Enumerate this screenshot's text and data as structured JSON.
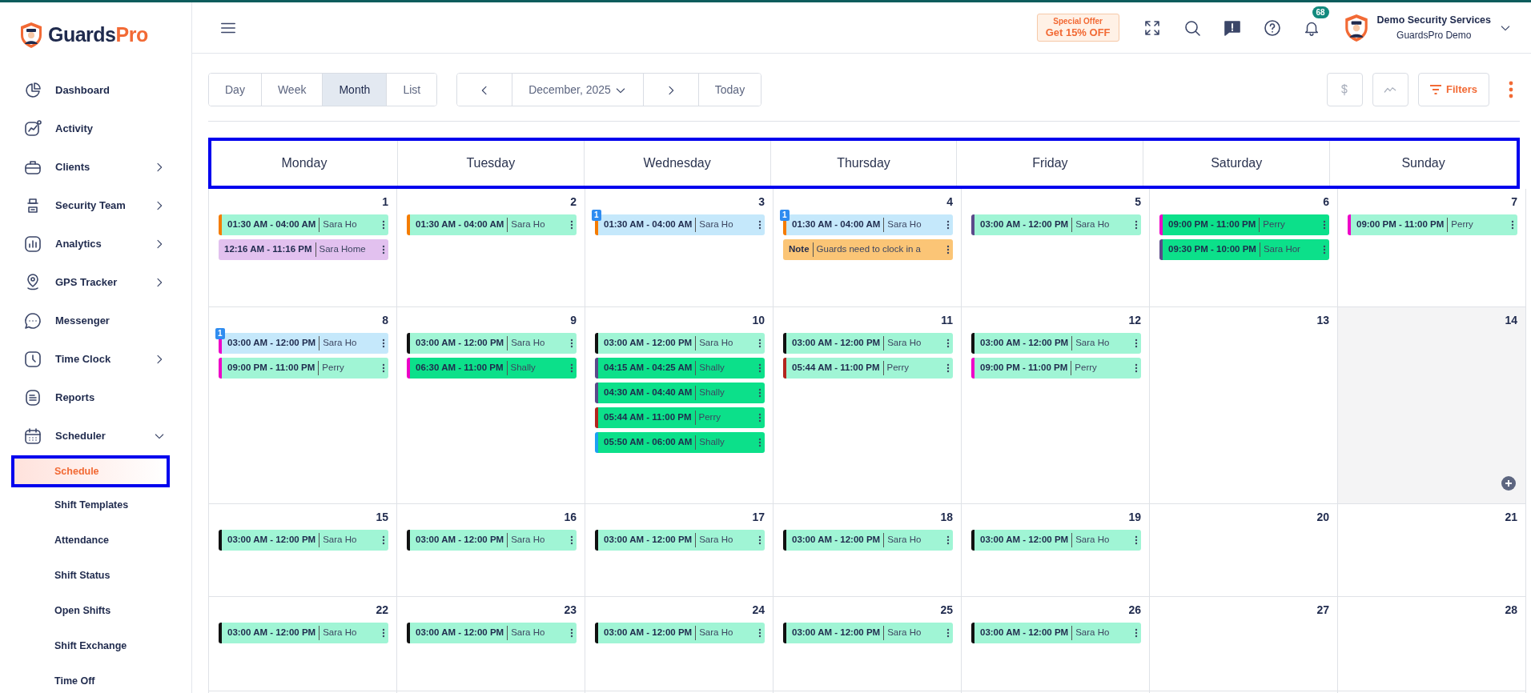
{
  "brand": {
    "main": "Guards",
    "accent": "Pro"
  },
  "sidebar": {
    "items": [
      {
        "label": "Dashboard"
      },
      {
        "label": "Activity"
      },
      {
        "label": "Clients",
        "expanded": false
      },
      {
        "label": "Security Team",
        "expanded": false
      },
      {
        "label": "Analytics",
        "expanded": false
      },
      {
        "label": "GPS Tracker",
        "expanded": false
      },
      {
        "label": "Messenger"
      },
      {
        "label": "Time Clock",
        "expanded": false
      },
      {
        "label": "Reports"
      },
      {
        "label": "Scheduler",
        "expanded": true,
        "children": [
          {
            "label": "Schedule",
            "selected": true
          },
          {
            "label": "Shift Templates",
            "selected": false
          },
          {
            "label": "Attendance",
            "selected": false
          },
          {
            "label": "Shift Status",
            "selected": false
          },
          {
            "label": "Open Shifts",
            "selected": false
          },
          {
            "label": "Shift Exchange",
            "selected": false
          },
          {
            "label": "Time Off",
            "selected": false
          }
        ]
      }
    ]
  },
  "topbar": {
    "offer": {
      "title": "Special Offer",
      "text": "Get 15% OFF"
    },
    "notifications": "68",
    "user": {
      "company": "Demo Security Services",
      "account": "GuardsPro Demo"
    }
  },
  "toolbar": {
    "views": [
      {
        "label": "Day",
        "selected": false
      },
      {
        "label": "Week",
        "selected": false
      },
      {
        "label": "Month",
        "selected": true
      },
      {
        "label": "List",
        "selected": false
      }
    ],
    "period": "December, 2025",
    "today": "Today",
    "filters": "Filters"
  },
  "calendar": {
    "weekdays": [
      "Monday",
      "Tuesday",
      "Wednesday",
      "Thursday",
      "Friday",
      "Saturday",
      "Sunday"
    ],
    "weeks": [
      [
        {
          "day": "1",
          "highlighted": false,
          "events": [
            {
              "kind": "shift",
              "time": "01:30 AM - 04:00 AM",
              "name": "Sara Ho",
              "color": "#f57c00"
            },
            {
              "kind": "allday",
              "time": "12:16 AM - 11:16 PM",
              "name": "Sara Home"
            }
          ]
        },
        {
          "day": "2",
          "highlighted": false,
          "events": [
            {
              "kind": "shift",
              "time": "01:30 AM - 04:00 AM",
              "name": "Sara Ho",
              "color": "#f57c00"
            }
          ]
        },
        {
          "day": "3",
          "highlighted": false,
          "events": [
            {
              "kind": "pending",
              "time": "01:30 AM - 04:00 AM",
              "name": "Sara Ho",
              "color": "#f57c00",
              "badge": "1"
            }
          ]
        },
        {
          "day": "4",
          "highlighted": false,
          "events": [
            {
              "kind": "pending",
              "time": "01:30 AM - 04:00 AM",
              "name": "Sara Ho",
              "color": "#f57c00",
              "badge": "1"
            },
            {
              "kind": "note",
              "label": "Note",
              "text": "Guards need to clock in a"
            }
          ]
        },
        {
          "day": "5",
          "highlighted": false,
          "events": [
            {
              "kind": "shift",
              "time": "03:00 AM - 12:00 PM",
              "name": "Sara Ho",
              "color": "#5b4a8a"
            }
          ]
        },
        {
          "day": "6",
          "highlighted": false,
          "events": [
            {
              "kind": "active",
              "time": "09:00 PM - 11:00 PM",
              "name": "Perry",
              "color": "#ee00c8"
            },
            {
              "kind": "active",
              "time": "09:30 PM - 10:00 PM",
              "name": "Sara Hor",
              "color": "#5b4a8a"
            }
          ]
        },
        {
          "day": "7",
          "highlighted": false,
          "events": [
            {
              "kind": "shift",
              "time": "09:00 PM - 11:00 PM",
              "name": "Perry",
              "color": "#ee00c8"
            }
          ]
        }
      ],
      [
        {
          "day": "8",
          "highlighted": false,
          "events": [
            {
              "kind": "pending",
              "time": "03:00 AM - 12:00 PM",
              "name": "Sara Ho",
              "color": "#ee00c8",
              "badge": "1"
            },
            {
              "kind": "shift",
              "time": "09:00 PM - 11:00 PM",
              "name": "Perry",
              "color": "#ee00c8"
            }
          ]
        },
        {
          "day": "9",
          "highlighted": false,
          "events": [
            {
              "kind": "shift",
              "time": "03:00 AM - 12:00 PM",
              "name": "Sara Ho",
              "color": "#111111"
            },
            {
              "kind": "active",
              "time": "06:30 AM - 11:00 PM",
              "name": "Shally",
              "color": "#ee00c8"
            }
          ]
        },
        {
          "day": "10",
          "highlighted": false,
          "events": [
            {
              "kind": "shift",
              "time": "03:00 AM - 12:00 PM",
              "name": "Sara Ho",
              "color": "#111111"
            },
            {
              "kind": "active",
              "time": "04:15 AM - 04:25 AM",
              "name": "Shally",
              "color": "#5b4a8a"
            },
            {
              "kind": "active",
              "time": "04:30 AM - 04:40 AM",
              "name": "Shally",
              "color": "#5b4a8a"
            },
            {
              "kind": "active",
              "time": "05:44 AM - 11:00 PM",
              "name": "Perry",
              "color": "#b3261e"
            },
            {
              "kind": "active",
              "time": "05:50 AM - 06:00 AM",
              "name": "Shally",
              "color": "#1da1f2"
            }
          ]
        },
        {
          "day": "11",
          "highlighted": false,
          "events": [
            {
              "kind": "shift",
              "time": "03:00 AM - 12:00 PM",
              "name": "Sara Ho",
              "color": "#111111"
            },
            {
              "kind": "shift",
              "time": "05:44 AM - 11:00 PM",
              "name": "Perry",
              "color": "#b3261e"
            }
          ]
        },
        {
          "day": "12",
          "highlighted": false,
          "events": [
            {
              "kind": "shift",
              "time": "03:00 AM - 12:00 PM",
              "name": "Sara Ho",
              "color": "#111111"
            },
            {
              "kind": "shift",
              "time": "09:00 PM - 11:00 PM",
              "name": "Perry",
              "color": "#ee00c8"
            }
          ]
        },
        {
          "day": "13",
          "highlighted": false
        },
        {
          "day": "14",
          "highlighted": true
        }
      ],
      [
        {
          "day": "15",
          "highlighted": false,
          "events": [
            {
              "kind": "shift",
              "time": "03:00 AM - 12:00 PM",
              "name": "Sara Ho",
              "color": "#111111"
            }
          ]
        },
        {
          "day": "16",
          "highlighted": false,
          "events": [
            {
              "kind": "shift",
              "time": "03:00 AM - 12:00 PM",
              "name": "Sara Ho",
              "color": "#111111"
            }
          ]
        },
        {
          "day": "17",
          "highlighted": false,
          "events": [
            {
              "kind": "shift",
              "time": "03:00 AM - 12:00 PM",
              "name": "Sara Ho",
              "color": "#111111"
            }
          ]
        },
        {
          "day": "18",
          "highlighted": false,
          "events": [
            {
              "kind": "shift",
              "time": "03:00 AM - 12:00 PM",
              "name": "Sara Ho",
              "color": "#111111"
            }
          ]
        },
        {
          "day": "19",
          "highlighted": false,
          "events": [
            {
              "kind": "shift",
              "time": "03:00 AM - 12:00 PM",
              "name": "Sara Ho",
              "color": "#111111"
            }
          ]
        },
        {
          "day": "20",
          "highlighted": false
        },
        {
          "day": "21",
          "highlighted": false
        }
      ],
      [
        {
          "day": "22",
          "highlighted": false,
          "events": [
            {
              "kind": "shift",
              "time": "03:00 AM - 12:00 PM",
              "name": "Sara Ho",
              "color": "#111111"
            }
          ]
        },
        {
          "day": "23",
          "highlighted": false,
          "events": [
            {
              "kind": "shift",
              "time": "03:00 AM - 12:00 PM",
              "name": "Sara Ho",
              "color": "#111111"
            }
          ]
        },
        {
          "day": "24",
          "highlighted": false,
          "events": [
            {
              "kind": "shift",
              "time": "03:00 AM - 12:00 PM",
              "name": "Sara Ho",
              "color": "#111111"
            }
          ]
        },
        {
          "day": "25",
          "highlighted": false,
          "events": [
            {
              "kind": "shift",
              "time": "03:00 AM - 12:00 PM",
              "name": "Sara Ho",
              "color": "#111111"
            }
          ]
        },
        {
          "day": "26",
          "highlighted": false,
          "events": [
            {
              "kind": "shift",
              "time": "03:00 AM - 12:00 PM",
              "name": "Sara Ho",
              "color": "#111111"
            }
          ]
        },
        {
          "day": "27",
          "highlighted": false
        },
        {
          "day": "28",
          "highlighted": false
        }
      ]
    ]
  }
}
